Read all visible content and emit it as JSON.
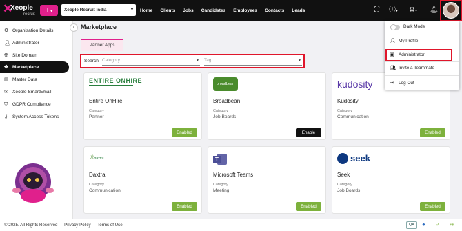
{
  "header": {
    "logo_name": "Xeople",
    "logo_sub": "recruit",
    "add_label": "+",
    "org": "Xeople Recruit India",
    "nav": [
      "Home",
      "Clients",
      "Jobs",
      "Candidates",
      "Employees",
      "Contacts",
      "Leads"
    ]
  },
  "sidebar": {
    "items": [
      {
        "label": "Organisation Details",
        "icon": "settings-icon"
      },
      {
        "label": "Administrator",
        "icon": "user-icon"
      },
      {
        "label": "Site Domain",
        "icon": "globe-icon"
      },
      {
        "label": "Marketplace",
        "icon": "marketplace-icon"
      },
      {
        "label": "Master Data",
        "icon": "database-icon"
      },
      {
        "label": "Xeople SmartEmail",
        "icon": "email-icon"
      },
      {
        "label": "GDPR Compliance",
        "icon": "shield-icon"
      },
      {
        "label": "System Access Tokens",
        "icon": "key-icon"
      }
    ]
  },
  "main": {
    "title": "Marketplace",
    "tab": "Partner Apps",
    "search_label": "Search",
    "category_placeholder": "Category",
    "tag_placeholder": "Tag"
  },
  "cards": [
    {
      "logo": "ENTIRE ONHIRE",
      "name": "Entire OnHire",
      "category_label": "Category",
      "category": "Partner",
      "button": "Enabled"
    },
    {
      "logo": "broadbean",
      "name": "Broadbean",
      "category_label": "Category",
      "category": "Job Boards",
      "button": "Enable"
    },
    {
      "logo": "kudosity",
      "name": "Kudosity",
      "category_label": "Category",
      "category": "Communication",
      "button": "Enabled"
    },
    {
      "logo": "daxtra",
      "name": "Daxtra",
      "category_label": "Category",
      "category": "Communication",
      "button": "Enabled"
    },
    {
      "logo": "Teams",
      "name": "Microsoft Teams",
      "category_label": "Category",
      "category": "Meeting",
      "button": "Enabled"
    },
    {
      "logo": "seek",
      "name": "Seek",
      "category_label": "Category",
      "category": "Job Boards",
      "button": "Enabled"
    }
  ],
  "dropdown": {
    "items": [
      "Dark Mode",
      "My Profile",
      "Administrator",
      "Invite a Teammate",
      "Log Out"
    ]
  },
  "footer": {
    "copyright": "© 2025. All Rights Reserved",
    "privacy": "Privacy Policy",
    "terms": "Terms of Use",
    "qa": "QA"
  },
  "colors": {
    "brand_pink": "#e0208c",
    "enabled_green": "#7db13c",
    "highlight_red": "#e0162b"
  }
}
